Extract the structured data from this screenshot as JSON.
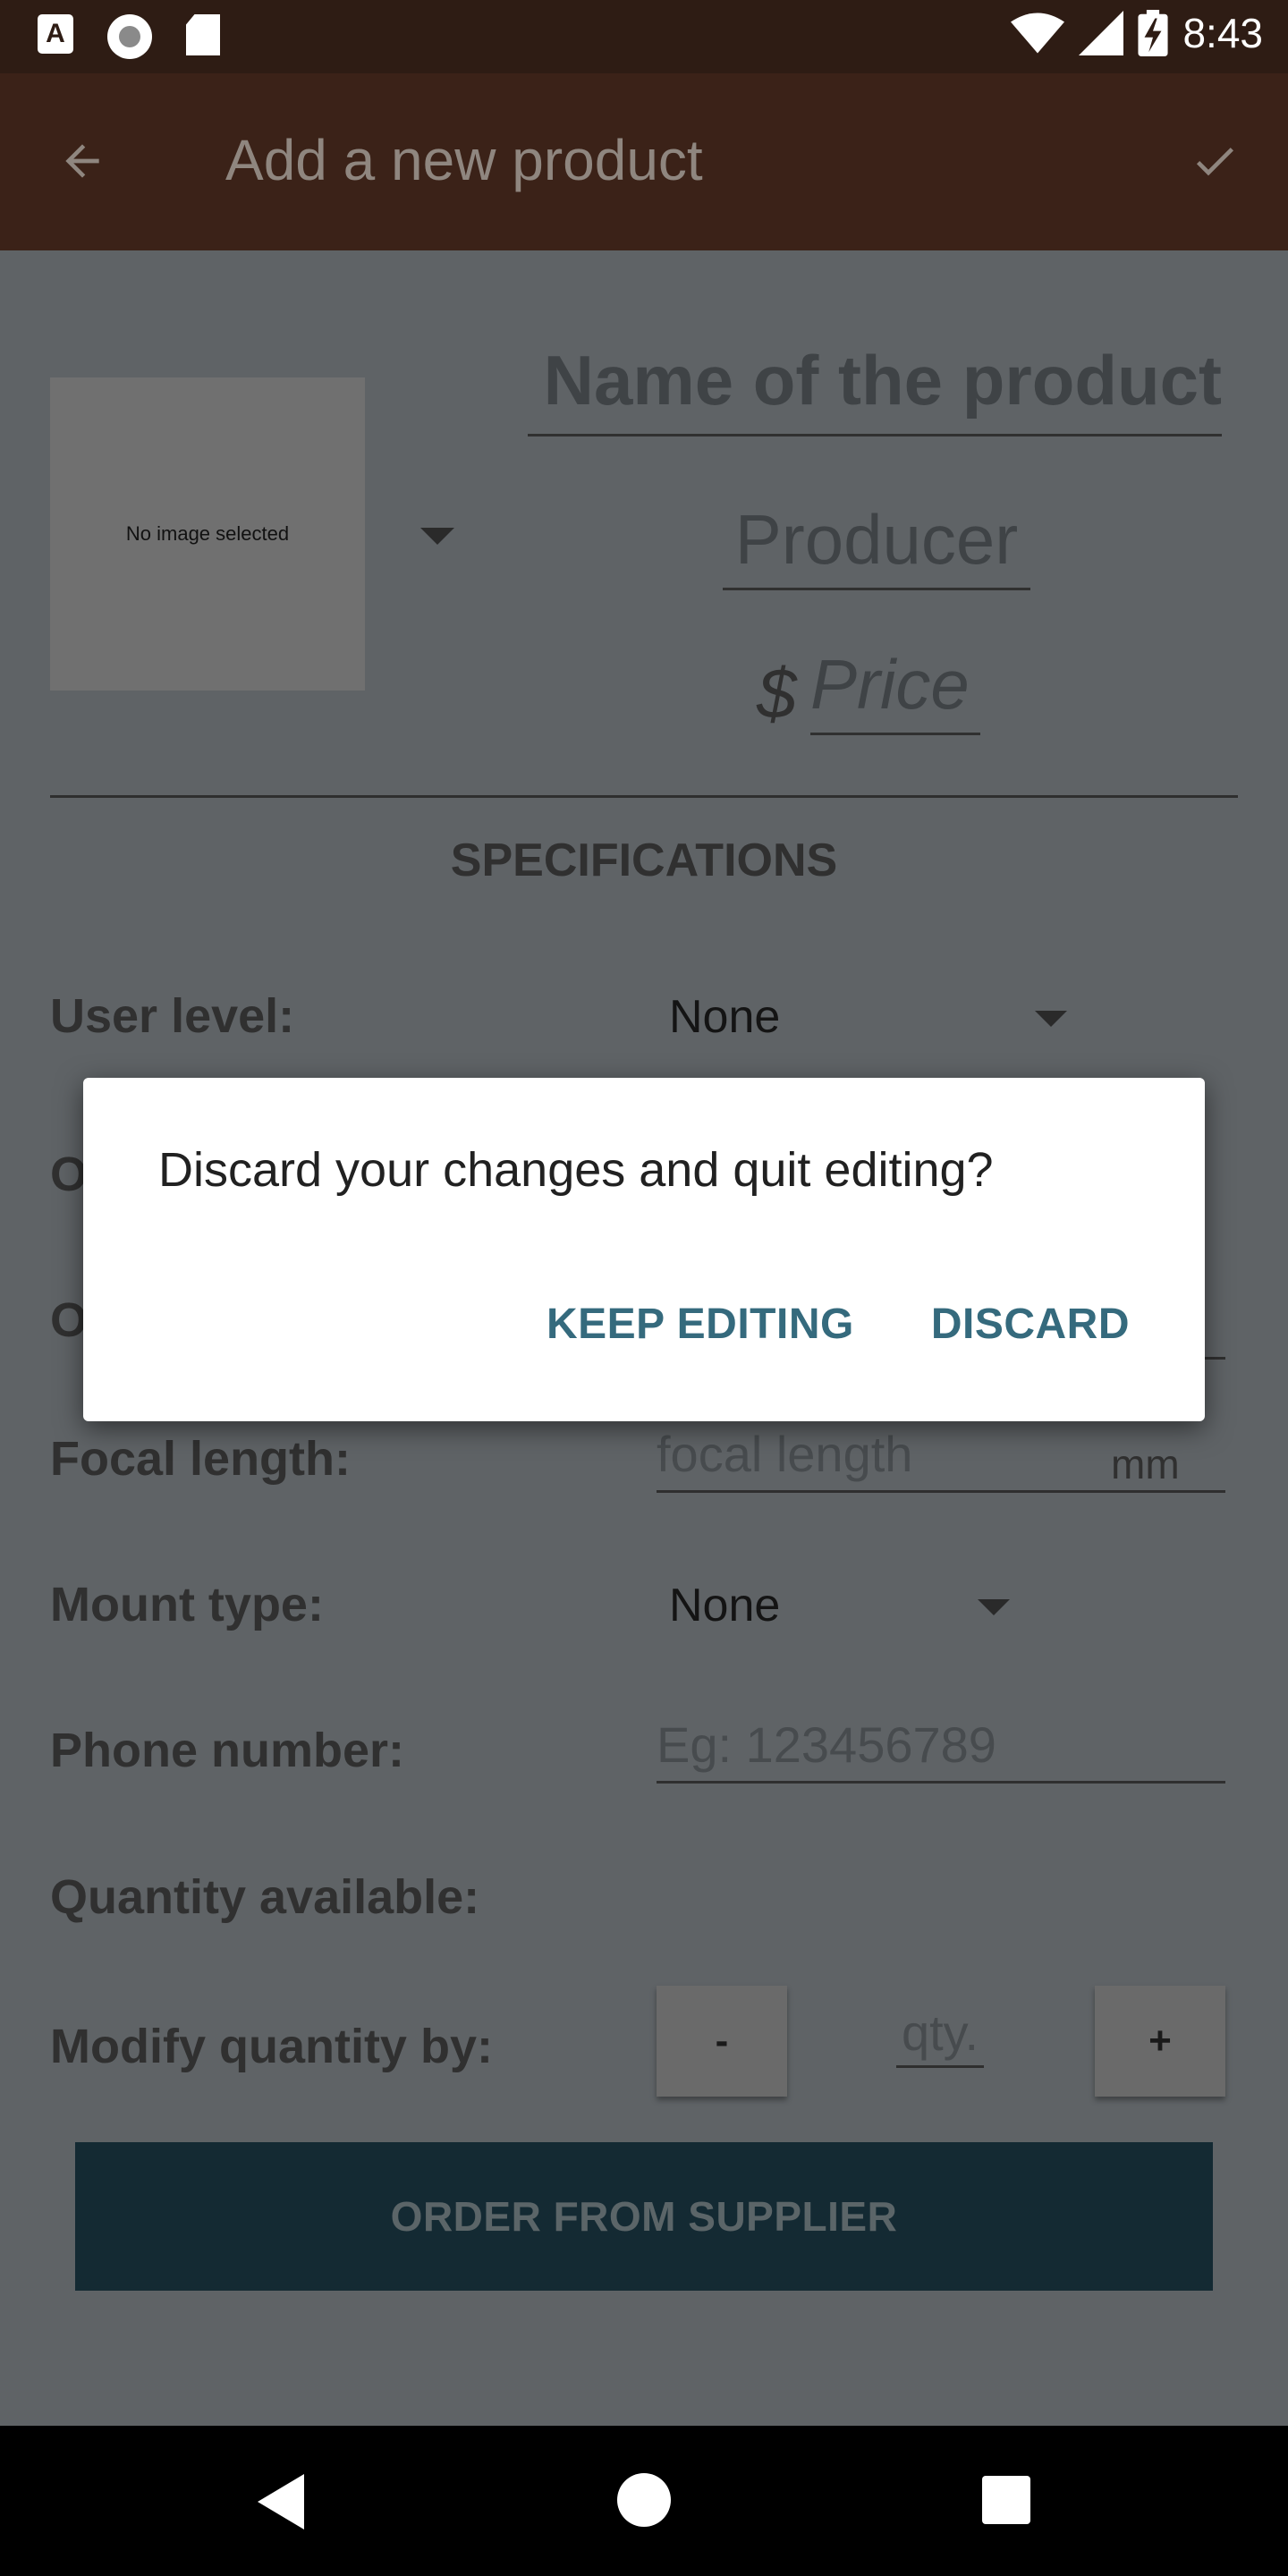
{
  "status_bar": {
    "time": "8:43"
  },
  "app_bar": {
    "title": "Add a new product"
  },
  "product": {
    "image_placeholder": "No image selected",
    "name_placeholder": "Name of the product",
    "producer_placeholder": "Producer",
    "currency_symbol": "$",
    "price_placeholder": "Price"
  },
  "specifications": {
    "heading": "SPECIFICATIONS",
    "user_level": {
      "label": "User level:",
      "value": "None"
    },
    "focal_length": {
      "label": "Focal length:",
      "placeholder": "focal length",
      "unit": "mm"
    },
    "mount_type": {
      "label": "Mount type:",
      "value": "None"
    },
    "phone_number": {
      "label": "Phone number:",
      "placeholder": "Eg: 123456789"
    },
    "quantity_available": {
      "label": "Quantity available:"
    },
    "modify_quantity": {
      "label": "Modify quantity by:",
      "minus": "-",
      "plus": "+",
      "placeholder": "qty."
    }
  },
  "order_button": "ORDER FROM SUPPLIER",
  "dialog": {
    "message": "Discard your changes and quit editing?",
    "keep_editing": "KEEP EDITING",
    "discard": "DISCARD"
  },
  "colors": {
    "app_bar": "#3b2218",
    "status_bar": "#2e1c14",
    "scrim_background": "#5f6366",
    "dialog_action": "#356a7d",
    "order_button": "#142a33"
  }
}
